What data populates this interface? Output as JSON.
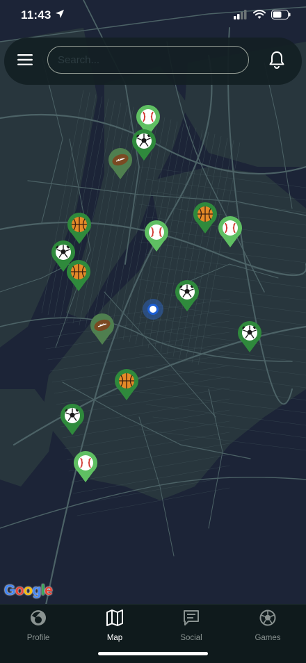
{
  "status_bar": {
    "time": "11:43",
    "icons": [
      "location-arrow-icon",
      "signal-icon",
      "wifi-icon",
      "battery-icon"
    ]
  },
  "top_bar": {
    "menu_icon": "hamburger-menu-icon",
    "search": {
      "placeholder": "Search...",
      "value": ""
    },
    "notification_icon": "bell-icon"
  },
  "map": {
    "provider_logo": "Google",
    "colors": {
      "background": "#1c2437",
      "roads": "#4c6266",
      "water": "#1c2437",
      "land": "#2a3940",
      "marker_light": "#5fbf62",
      "marker_dark": "#2f8a3c",
      "marker_olive": "#4f7f4f",
      "user_location": "#1d5fd6"
    },
    "markers": [
      {
        "sport": "baseball",
        "icon": "baseball-icon",
        "tone": "light"
      },
      {
        "sport": "soccer",
        "icon": "soccer-ball-icon",
        "tone": "dark"
      },
      {
        "sport": "football",
        "icon": "football-icon",
        "tone": "olive"
      },
      {
        "sport": "basketball",
        "icon": "basketball-icon",
        "tone": "dark"
      },
      {
        "sport": "basketball",
        "icon": "basketball-icon",
        "tone": "dark"
      },
      {
        "sport": "baseball",
        "icon": "baseball-icon",
        "tone": "light"
      },
      {
        "sport": "baseball",
        "icon": "baseball-icon",
        "tone": "light"
      },
      {
        "sport": "soccer",
        "icon": "soccer-ball-icon",
        "tone": "dark"
      },
      {
        "sport": "basketball",
        "icon": "basketball-icon",
        "tone": "dark"
      },
      {
        "sport": "soccer",
        "icon": "soccer-ball-icon",
        "tone": "dark"
      },
      {
        "sport": "football",
        "icon": "football-icon",
        "tone": "olive"
      },
      {
        "sport": "soccer",
        "icon": "soccer-ball-icon",
        "tone": "dark"
      },
      {
        "sport": "basketball",
        "icon": "basketball-icon",
        "tone": "dark"
      },
      {
        "sport": "soccer",
        "icon": "soccer-ball-icon",
        "tone": "dark"
      },
      {
        "sport": "baseball",
        "icon": "baseball-icon",
        "tone": "light"
      }
    ]
  },
  "bottom_nav": {
    "items": [
      {
        "label": "Profile",
        "icon": "profile-icon",
        "active": false
      },
      {
        "label": "Map",
        "icon": "map-icon",
        "active": true
      },
      {
        "label": "Social",
        "icon": "chat-icon",
        "active": false
      },
      {
        "label": "Games",
        "icon": "soccer-ball-icon",
        "active": false
      }
    ]
  }
}
